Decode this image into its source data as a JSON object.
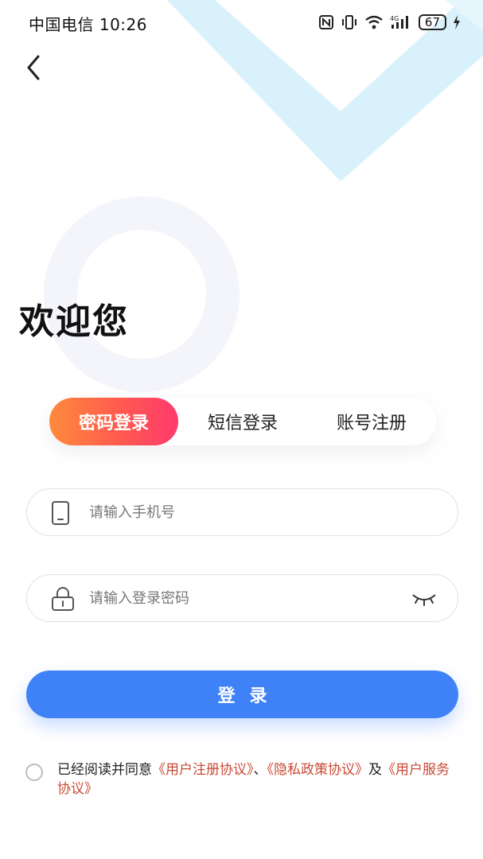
{
  "status_bar": {
    "carrier_time": "中国电信 10:26",
    "battery": "67"
  },
  "header": {
    "title": "欢迎您"
  },
  "tabs": [
    {
      "label": "密码登录",
      "active": true
    },
    {
      "label": "短信登录",
      "active": false
    },
    {
      "label": "账号注册",
      "active": false
    }
  ],
  "form": {
    "phone_placeholder": "请输入手机号",
    "password_placeholder": "请输入登录密码",
    "login_label": "登录"
  },
  "agreement": {
    "prefix": "已经阅读并同意",
    "link1": "《用户注册协议》",
    "sep": "、",
    "link2": "《隐私政策协议》",
    "and": "及",
    "link3": "《用户服务协议》"
  },
  "colors": {
    "primary": "#3f82f7",
    "tab_gradient_start": "#ff8a3d",
    "tab_gradient_end": "#ff3a6d",
    "link": "#c94a34"
  }
}
